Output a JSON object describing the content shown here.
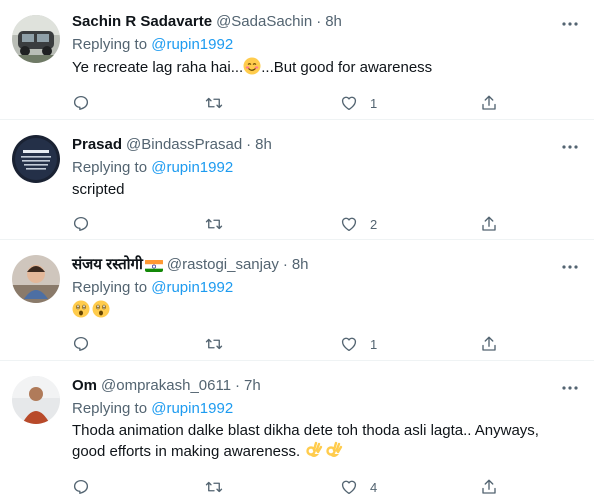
{
  "tweets": [
    {
      "name": "Sachin R Sadavarte",
      "handle": "@SadaSachin",
      "dot": "·",
      "time": "8h",
      "replying_prefix": "Replying to",
      "mention": "@rupin1992",
      "text_before": "Ye recreate lag raha hai...",
      "text_after": "...But good for awareness",
      "reply_count": "",
      "retweet_count": "",
      "like_count": "1",
      "avatar": "avatar-car-photo"
    },
    {
      "name": "Prasad",
      "handle": "@BindassPrasad",
      "dot": "·",
      "time": "8h",
      "replying_prefix": "Replying to",
      "mention": "@rupin1992",
      "text": "scripted",
      "reply_count": "",
      "retweet_count": "",
      "like_count": "2",
      "avatar": "avatar-freedom-quote"
    },
    {
      "name": "संजय रस्तोगी",
      "handle": "@rastogi_sanjay",
      "dot": "·",
      "time": "8h",
      "replying_prefix": "Replying to",
      "mention": "@rupin1992",
      "text": "",
      "reply_count": "",
      "retweet_count": "",
      "like_count": "1",
      "avatar": "avatar-child-photo",
      "flag": "india-flag-icon"
    },
    {
      "name": "Om",
      "handle": "@omprakash_0611",
      "dot": "·",
      "time": "7h",
      "replying_prefix": "Replying to",
      "mention": "@rupin1992",
      "text_line1": "Thoda animation dalke blast dikha dete toh thoda asli lagta.. Anyways,",
      "text_line2": "good efforts in making awareness.",
      "reply_count": "",
      "retweet_count": "",
      "like_count": "4",
      "avatar": "avatar-person-photo"
    }
  ],
  "colors": {
    "text": "#0f1419",
    "muted": "#536471",
    "link": "#1d9bf0",
    "divider": "#eff3f4"
  },
  "icons": [
    "reply-icon",
    "retweet-icon",
    "like-icon",
    "share-icon",
    "more-icon",
    "smiling-face-emoji",
    "astonished-face-emoji",
    "ok-hand-emoji"
  ]
}
